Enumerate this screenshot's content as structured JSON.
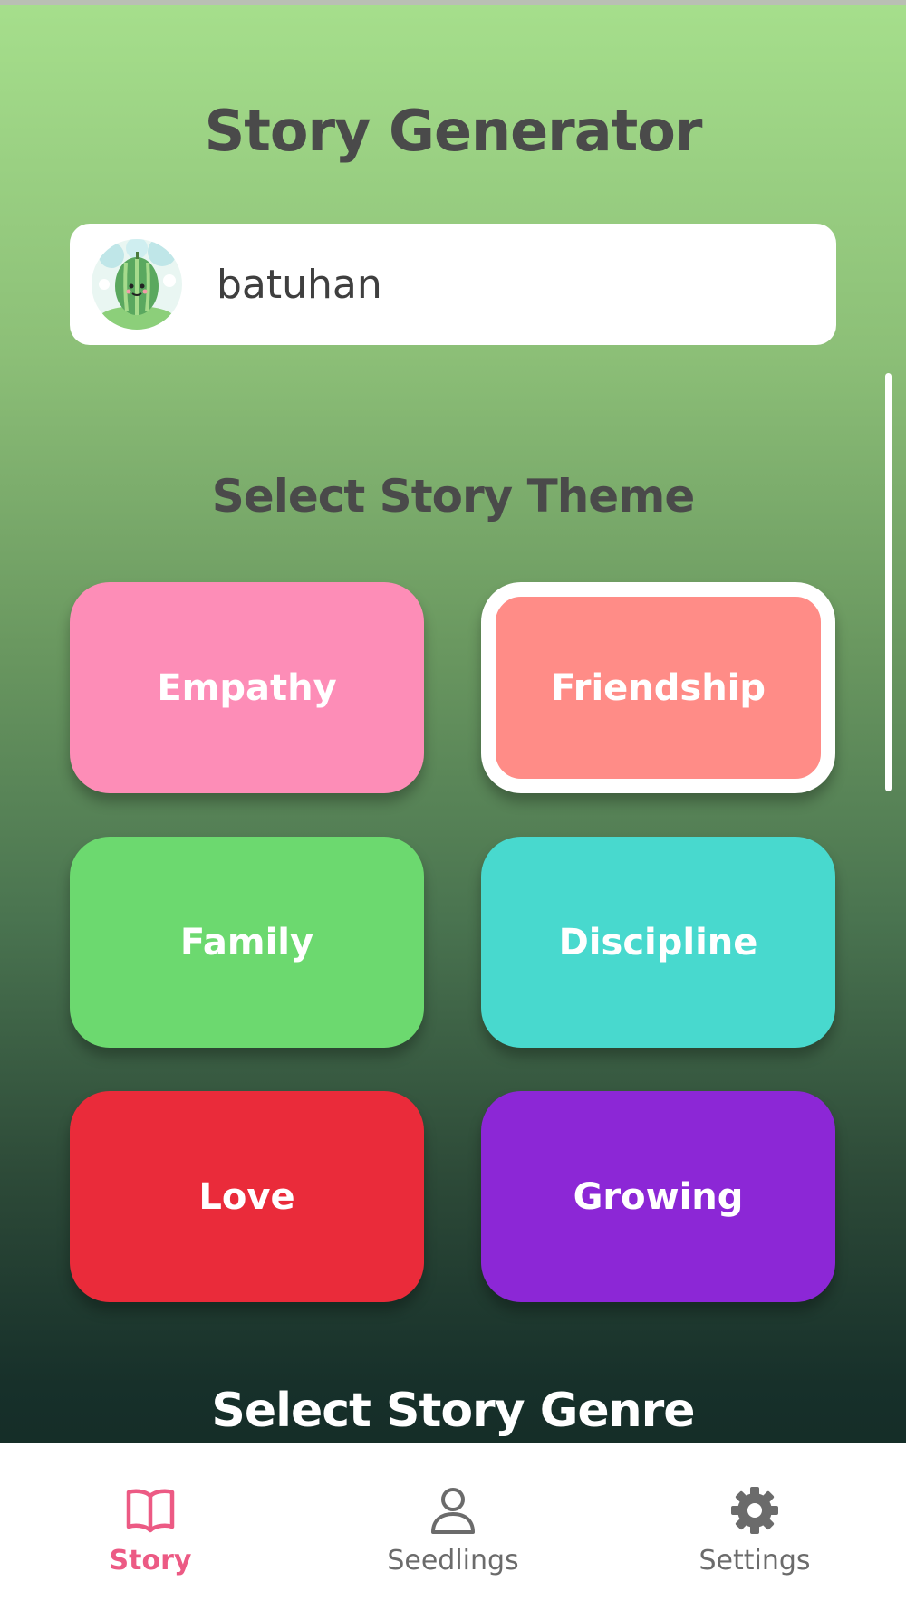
{
  "header": {
    "title": "Story Generator"
  },
  "user": {
    "name": "batuhan",
    "avatar_icon": "watermelon-character-avatar"
  },
  "theme_section": {
    "title": "Select Story Theme",
    "selected": "Friendship",
    "themes": [
      {
        "label": "Empathy",
        "color": "#fd8db7"
      },
      {
        "label": "Friendship",
        "color": "#ff8c87"
      },
      {
        "label": "Family",
        "color": "#6cd96f"
      },
      {
        "label": "Discipline",
        "color": "#48d9ce"
      },
      {
        "label": "Love",
        "color": "#ea2b3a"
      },
      {
        "label": "Growing",
        "color": "#8c27d6"
      }
    ]
  },
  "genre_section": {
    "title": "Select Story Genre"
  },
  "bottom_nav": {
    "active": "Story",
    "active_color": "#ec5a84",
    "items": [
      {
        "label": "Story",
        "icon": "book-icon"
      },
      {
        "label": "Seedlings",
        "icon": "person-icon"
      },
      {
        "label": "Settings",
        "icon": "gear-icon"
      }
    ]
  }
}
